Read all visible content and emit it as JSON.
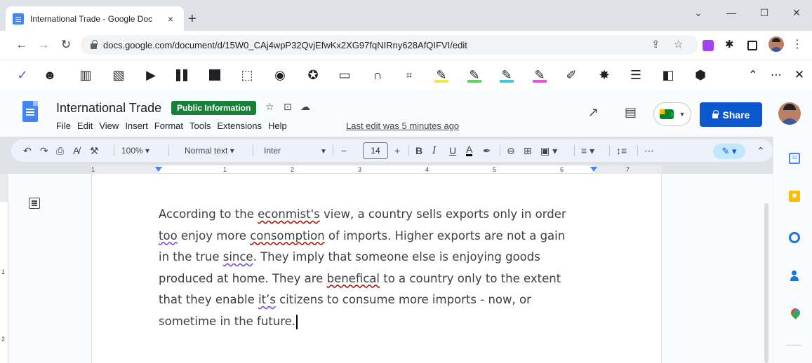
{
  "browser": {
    "tab_title": "International Trade - Google Doc",
    "tab_close": "×",
    "new_tab": "+",
    "win_menu": "⌄",
    "win_min": "—",
    "win_max": "☐",
    "win_close": "✕",
    "back": "←",
    "forward": "→",
    "reload": "↻",
    "url": "docs.google.com/document/d/15W0_CAj4wpP32QvjEfwKx2XG97fqNIRny628AfQIFVI/edit",
    "menu": "⋮"
  },
  "extension_toolbar": {
    "icons": [
      "checkmark-icon",
      "speaker-head-icon",
      "book-icon",
      "image-icon",
      "play-icon",
      "pause-icon",
      "stop-icon",
      "screen-select-icon",
      "text-to-speech-icon",
      "voice-icon",
      "screen-mask-icon",
      "headphones-icon",
      "translate-icon",
      "highlighter-yellow-icon",
      "highlighter-green-icon",
      "highlighter-cyan-icon",
      "highlighter-pink-icon",
      "eraser-icon",
      "settings-icon",
      "list-icon",
      "dictionary-icon",
      "collect-icon"
    ],
    "collapse": "⌃",
    "more": "⋯",
    "close": "✕",
    "highlight_colors": [
      "#f4e842",
      "#5cd65c",
      "#3ec9e6",
      "#e94fd8"
    ]
  },
  "doc_header": {
    "title": "International Trade",
    "badge": "Public Information",
    "badge_color": "#188038",
    "menus": [
      "File",
      "Edit",
      "View",
      "Insert",
      "Format",
      "Tools",
      "Extensions",
      "Help"
    ],
    "last_edit": "Last edit was 5 minutes ago",
    "share": "Share",
    "share_color": "#0b57d0"
  },
  "format_toolbar": {
    "zoom": "100%",
    "style": "Normal text",
    "font": "Inter",
    "font_size": "14",
    "minus": "−",
    "plus": "+",
    "bold": "B",
    "italic": "I",
    "underline": "U",
    "text_color": "A",
    "more": "⋯"
  },
  "ruler": {
    "numbers": [
      "1",
      "1",
      "2",
      "3",
      "4",
      "5",
      "6",
      "7"
    ],
    "vertical_numbers": [
      "1",
      "2"
    ]
  },
  "document": {
    "lines": [
      [
        "According to the ",
        "econmist's",
        " view, a country sells exports only in order"
      ],
      [
        "too",
        " enjoy more ",
        "consomption",
        " of imports. Higher exports are not a gain"
      ],
      [
        "in the true ",
        "since",
        ". They imply that someone else is enjoying goods"
      ],
      [
        "produced at home. They are ",
        "benefical",
        " to a country only to the extent"
      ],
      [
        "that they enable ",
        "it’s",
        " citizens to consume more imports - now, or"
      ],
      [
        "sometime in the future."
      ]
    ]
  },
  "side_panel": {
    "calendar_day": "31"
  }
}
